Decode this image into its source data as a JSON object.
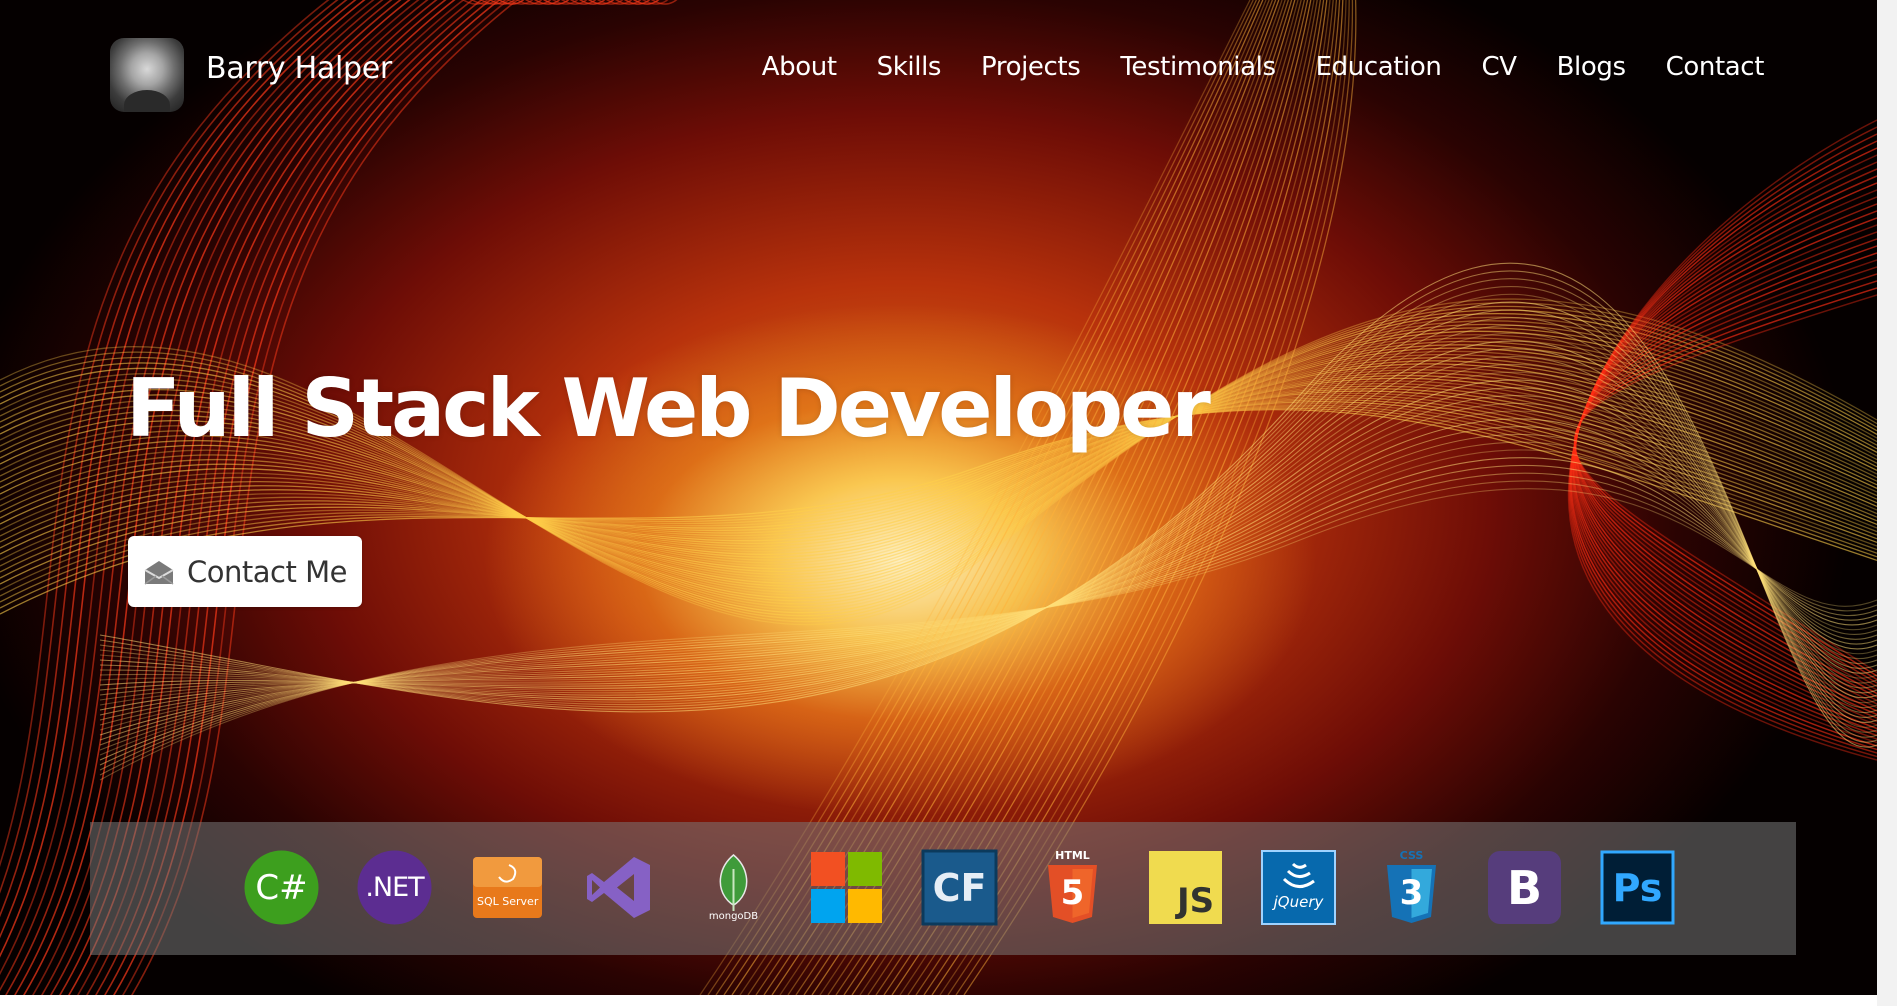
{
  "header": {
    "brand_name": "Barry Halper",
    "nav": [
      "About",
      "Skills",
      "Projects",
      "Testimonials",
      "Education",
      "CV",
      "Blogs",
      "Contact"
    ]
  },
  "hero": {
    "headline": "Full Stack Web Developer",
    "cta_label": "Contact Me"
  },
  "techbar": {
    "logos": [
      {
        "name": "csharp-logo",
        "text": "C#",
        "color": "#3d9f1e"
      },
      {
        "name": "dotnet-logo",
        "text": ".NET",
        "color": "#5c2d91"
      },
      {
        "name": "sql-server-logo",
        "text": "SQL Server",
        "color": "#e8791b"
      },
      {
        "name": "visual-studio-logo",
        "text": "",
        "color": "#8661c5"
      },
      {
        "name": "mongodb-logo",
        "text": "mongoDB",
        "color": "#3f9b3a"
      },
      {
        "name": "microsoft-logo",
        "text": "",
        "color": "#f25022"
      },
      {
        "name": "coldfusion-logo",
        "text": "CF",
        "color": "#1a5a8c"
      },
      {
        "name": "html5-logo",
        "text": "HTML",
        "text2": "5",
        "color": "#e34f26"
      },
      {
        "name": "javascript-logo",
        "text": "JS",
        "color": "#f0db4f"
      },
      {
        "name": "jquery-logo",
        "text": "jQuery",
        "color": "#0769ad"
      },
      {
        "name": "css3-logo",
        "text": "CSS",
        "text2": "3",
        "color": "#1572b6"
      },
      {
        "name": "bootstrap-logo",
        "text": "B",
        "color": "#563d7c"
      },
      {
        "name": "photoshop-logo",
        "text": "Ps",
        "color": "#31a8ff"
      }
    ]
  }
}
